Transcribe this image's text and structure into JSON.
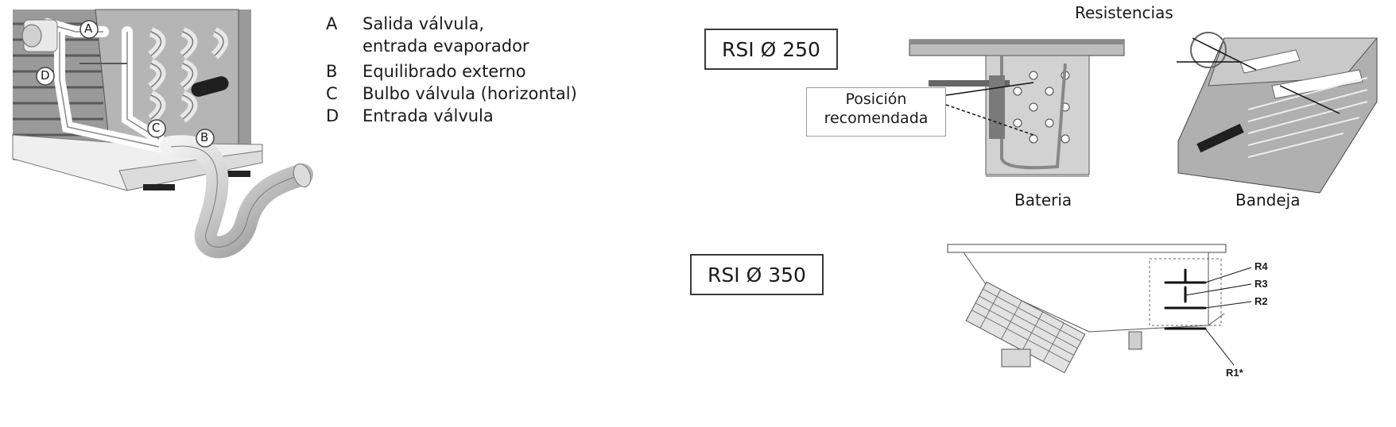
{
  "legend": [
    {
      "key": "A",
      "lines": [
        "Salida válvula,",
        "entrada evaporador"
      ]
    },
    {
      "key": "B",
      "lines": [
        "Equilibrado externo"
      ]
    },
    {
      "key": "C",
      "lines": [
        "Bulbo válvula (horizontal)"
      ]
    },
    {
      "key": "D",
      "lines": [
        "Entrada válvula"
      ]
    }
  ],
  "valve_callouts": [
    "A",
    "B",
    "C",
    "D"
  ],
  "rsi250": {
    "label": "RSI Ø 250",
    "heading": "Resistencias",
    "position_note_line1": "Posición",
    "position_note_line2": "recomendada",
    "battery_label": "Bateria",
    "tray_label": "Bandeja"
  },
  "rsi350": {
    "label": "RSI Ø 350",
    "resistors": [
      "R4",
      "R3",
      "R2",
      "R1*"
    ]
  }
}
